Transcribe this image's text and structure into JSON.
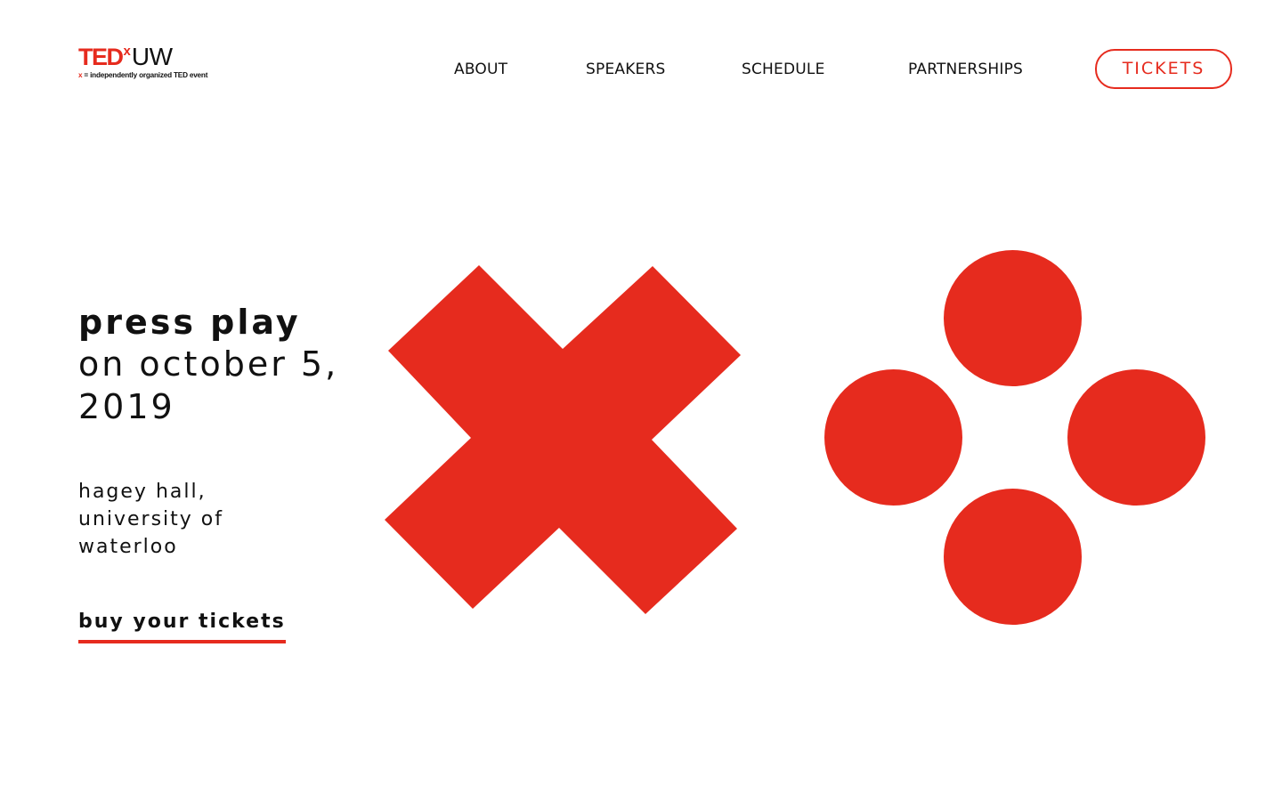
{
  "header": {
    "logo": {
      "brand": "TED",
      "superscript": "x",
      "suffix": "UW",
      "tagline_x": "x",
      "tagline_rest": " = independently organized TED event"
    },
    "nav": {
      "about": "ABOUT",
      "speakers": "SPEAKERS",
      "schedule": "SCHEDULE",
      "partnerships": "PARTNERSHIPS"
    },
    "tickets_label": "TICKETS"
  },
  "hero": {
    "title": "press play",
    "date": "on october 5, 2019",
    "venue": "hagey hall, university of waterloo",
    "cta_label": "buy your tickets"
  },
  "graphics": {
    "cross_icon": "x-cross-icon",
    "dots_icon": "four-dots-icon",
    "accent_color": "#e62b1e"
  },
  "colors": {
    "accent": "#e62b1e",
    "text": "#111111",
    "background": "#ffffff"
  }
}
